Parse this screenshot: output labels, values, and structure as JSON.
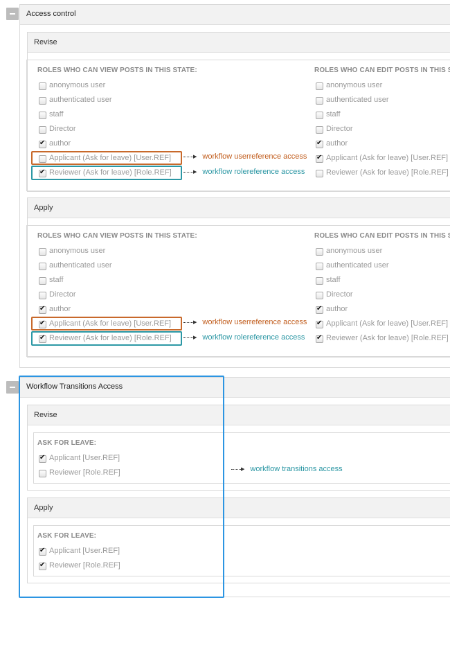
{
  "access_control": {
    "title": "Access control",
    "states": [
      {
        "name": "Revise",
        "view_header": "ROLES WHO CAN VIEW POSTS IN THIS STATE:",
        "edit_header": "ROLES WHO CAN EDIT POSTS IN THIS S",
        "view_roles": [
          {
            "label": "anonymous user",
            "checked": false
          },
          {
            "label": "authenticated user",
            "checked": false
          },
          {
            "label": "staff",
            "checked": false
          },
          {
            "label": "Director",
            "checked": false
          },
          {
            "label": "author",
            "checked": true
          },
          {
            "label": "Applicant (Ask for leave) [User.REF]",
            "checked": false
          },
          {
            "label": "Reviewer (Ask for leave) [Role.REF]",
            "checked": true
          }
        ],
        "edit_roles": [
          {
            "label": "anonymous user",
            "checked": false
          },
          {
            "label": "authenticated user",
            "checked": false
          },
          {
            "label": "staff",
            "checked": false
          },
          {
            "label": "Director",
            "checked": false
          },
          {
            "label": "author",
            "checked": true
          },
          {
            "label": "Applicant (Ask for leave) [User.REF]",
            "checked": true
          },
          {
            "label": "Reviewer (Ask for leave) [Role.REF]",
            "checked": false
          }
        ],
        "annotation_user": "workflow userreference access",
        "annotation_role": "workflow rolereference access"
      },
      {
        "name": "Apply",
        "view_header": "ROLES WHO CAN VIEW POSTS IN THIS STATE:",
        "edit_header": "ROLES WHO CAN EDIT POSTS IN THIS S",
        "view_roles": [
          {
            "label": "anonymous user",
            "checked": false
          },
          {
            "label": "authenticated user",
            "checked": false
          },
          {
            "label": "staff",
            "checked": false
          },
          {
            "label": "Director",
            "checked": false
          },
          {
            "label": "author",
            "checked": true
          },
          {
            "label": "Applicant (Ask for leave) [User.REF]",
            "checked": true
          },
          {
            "label": "Reviewer (Ask for leave) [Role.REF]",
            "checked": true
          }
        ],
        "edit_roles": [
          {
            "label": "anonymous user",
            "checked": false
          },
          {
            "label": "authenticated user",
            "checked": false
          },
          {
            "label": "staff",
            "checked": false
          },
          {
            "label": "Director",
            "checked": false
          },
          {
            "label": "author",
            "checked": true
          },
          {
            "label": "Applicant (Ask for leave) [User.REF]",
            "checked": true
          },
          {
            "label": "Reviewer (Ask for leave) [Role.REF]",
            "checked": true
          }
        ],
        "annotation_user": "workflow userreference access",
        "annotation_role": "workflow rolereference access"
      }
    ]
  },
  "transitions_access": {
    "title": "Workflow Transitions Access",
    "annotation": "workflow transitions access",
    "transitions": [
      {
        "name": "Revise",
        "header": "ASK FOR LEAVE:",
        "roles": [
          {
            "label": "Applicant [User.REF]",
            "checked": true
          },
          {
            "label": "Reviewer [Role.REF]",
            "checked": false
          }
        ]
      },
      {
        "name": "Apply",
        "header": "ASK FOR LEAVE:",
        "roles": [
          {
            "label": "Applicant [User.REF]",
            "checked": true
          },
          {
            "label": "Reviewer [Role.REF]",
            "checked": true
          }
        ]
      }
    ]
  },
  "colors": {
    "user_ref_highlight": "#c8692b",
    "role_ref_highlight": "#2c98a5",
    "transitions_highlight": "#2c95e2"
  }
}
